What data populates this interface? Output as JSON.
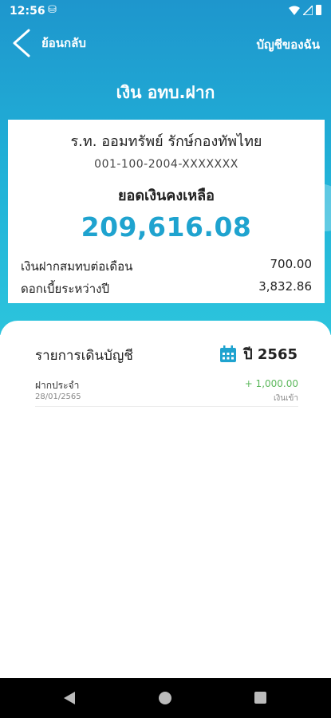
{
  "status_bar": {
    "time": "12:56",
    "app_icon": "⛁"
  },
  "nav": {
    "back_label": "ย้อนกลับ",
    "my_account_label": "บัญชีของฉัน"
  },
  "page_title": "เงิน อทบ.ฝาก",
  "account_card": {
    "bank_name": "ร.ท. ออมทรัพย์ รักษ์กองทัพไทย",
    "account_number": "001-100-2004-XXXXXXX",
    "balance_label": "ยอดเงินคงเหลือ",
    "balance_amount": "209,616.08",
    "monthly_deposit_label": "เงินฝากสมทบต่อเดือน",
    "monthly_deposit_value": "700.00",
    "interest_label": "ดอกเบี้ยระหว่างปี",
    "interest_value": "3,832.86"
  },
  "transactions": {
    "section_title": "รายการเดินบัญชี",
    "year_label": "ปี 2565",
    "items": [
      {
        "description": "ฝากประจำ",
        "date": "28/01/2565",
        "amount": "+ 1,000.00",
        "type": "เงินเข้า"
      }
    ]
  },
  "colors": {
    "primary": "#1fa3cf",
    "credit": "#5cb85c"
  }
}
